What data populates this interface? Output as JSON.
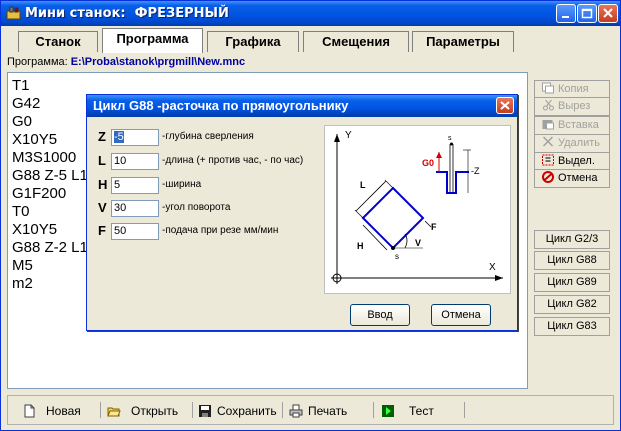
{
  "window": {
    "title": "Мини станок:  ФРЕЗЕРНЫЙ"
  },
  "tabs": [
    {
      "label": "Станок",
      "active": false
    },
    {
      "label": "Программа",
      "active": true
    },
    {
      "label": "Графика",
      "active": false
    },
    {
      "label": "Смещения",
      "active": false
    },
    {
      "label": "Параметры",
      "active": false
    }
  ],
  "program": {
    "label": "Программа:",
    "path": "E:\\Proba\\stanok\\prgmill\\New.mnc"
  },
  "editor": {
    "lines": [
      "T1",
      "G42",
      "G0",
      "X10Y5",
      "M3S1000",
      "G88 Z-5 L1",
      "G1F200",
      "T0",
      "X10Y5",
      "G88 Z-2 L1",
      "M5",
      "m2"
    ]
  },
  "side_buttons": [
    {
      "label": "Копия",
      "icon": "copy-icon",
      "enabled": false
    },
    {
      "label": "Вырез",
      "icon": "scissors-icon",
      "enabled": false
    },
    {
      "label": "Вставка",
      "icon": "paste-icon",
      "enabled": false
    },
    {
      "label": "Удалить",
      "icon": "delete-x-icon",
      "enabled": false
    },
    {
      "label": "Выдел.",
      "icon": "select-all-icon",
      "enabled": true
    },
    {
      "label": "Отмена",
      "icon": "cancel-circle-icon",
      "enabled": true
    }
  ],
  "cycle_buttons": [
    "Цикл G2/3",
    "Цикл G88",
    "Цикл G89",
    "Цикл G82",
    "Цикл G83"
  ],
  "bottom_buttons": [
    {
      "label": "Новая",
      "icon": "new-file-icon"
    },
    {
      "label": "Открыть",
      "icon": "open-icon"
    },
    {
      "label": "Сохранить",
      "icon": "save-icon"
    },
    {
      "label": "Печать",
      "icon": "print-icon"
    },
    {
      "label": "Тест",
      "icon": "test-icon"
    }
  ],
  "dialog": {
    "title": "Цикл G88 -расточка по прямоугольнику",
    "params": [
      {
        "letter": "Z",
        "value": "-5",
        "desc": "-глубина сверления",
        "selected": true
      },
      {
        "letter": "L",
        "value": "10",
        "desc": "-длина (+ против час, - по час)",
        "selected": false
      },
      {
        "letter": "H",
        "value": "5",
        "desc": "-ширина",
        "selected": false
      },
      {
        "letter": "V",
        "value": "30",
        "desc": "-угол поворота",
        "selected": false
      },
      {
        "letter": "F",
        "value": "50",
        "desc": "-подача при резе мм/мин",
        "selected": false
      }
    ],
    "diagram_labels": {
      "y": "Y",
      "x": "X",
      "l": "L",
      "h": "H",
      "v": "V",
      "f": "F",
      "s1": "s",
      "s2": "s",
      "g0": "G0",
      "z": "-Z"
    },
    "ok_label": "Ввод",
    "cancel_label": "Отмена"
  },
  "colors": {
    "title_blue": "#0054e3",
    "path_blue": "#0000a0",
    "diagram_rect": "#0000cc",
    "g0_red": "#cc0000",
    "cancel_red": "#cc0000"
  }
}
